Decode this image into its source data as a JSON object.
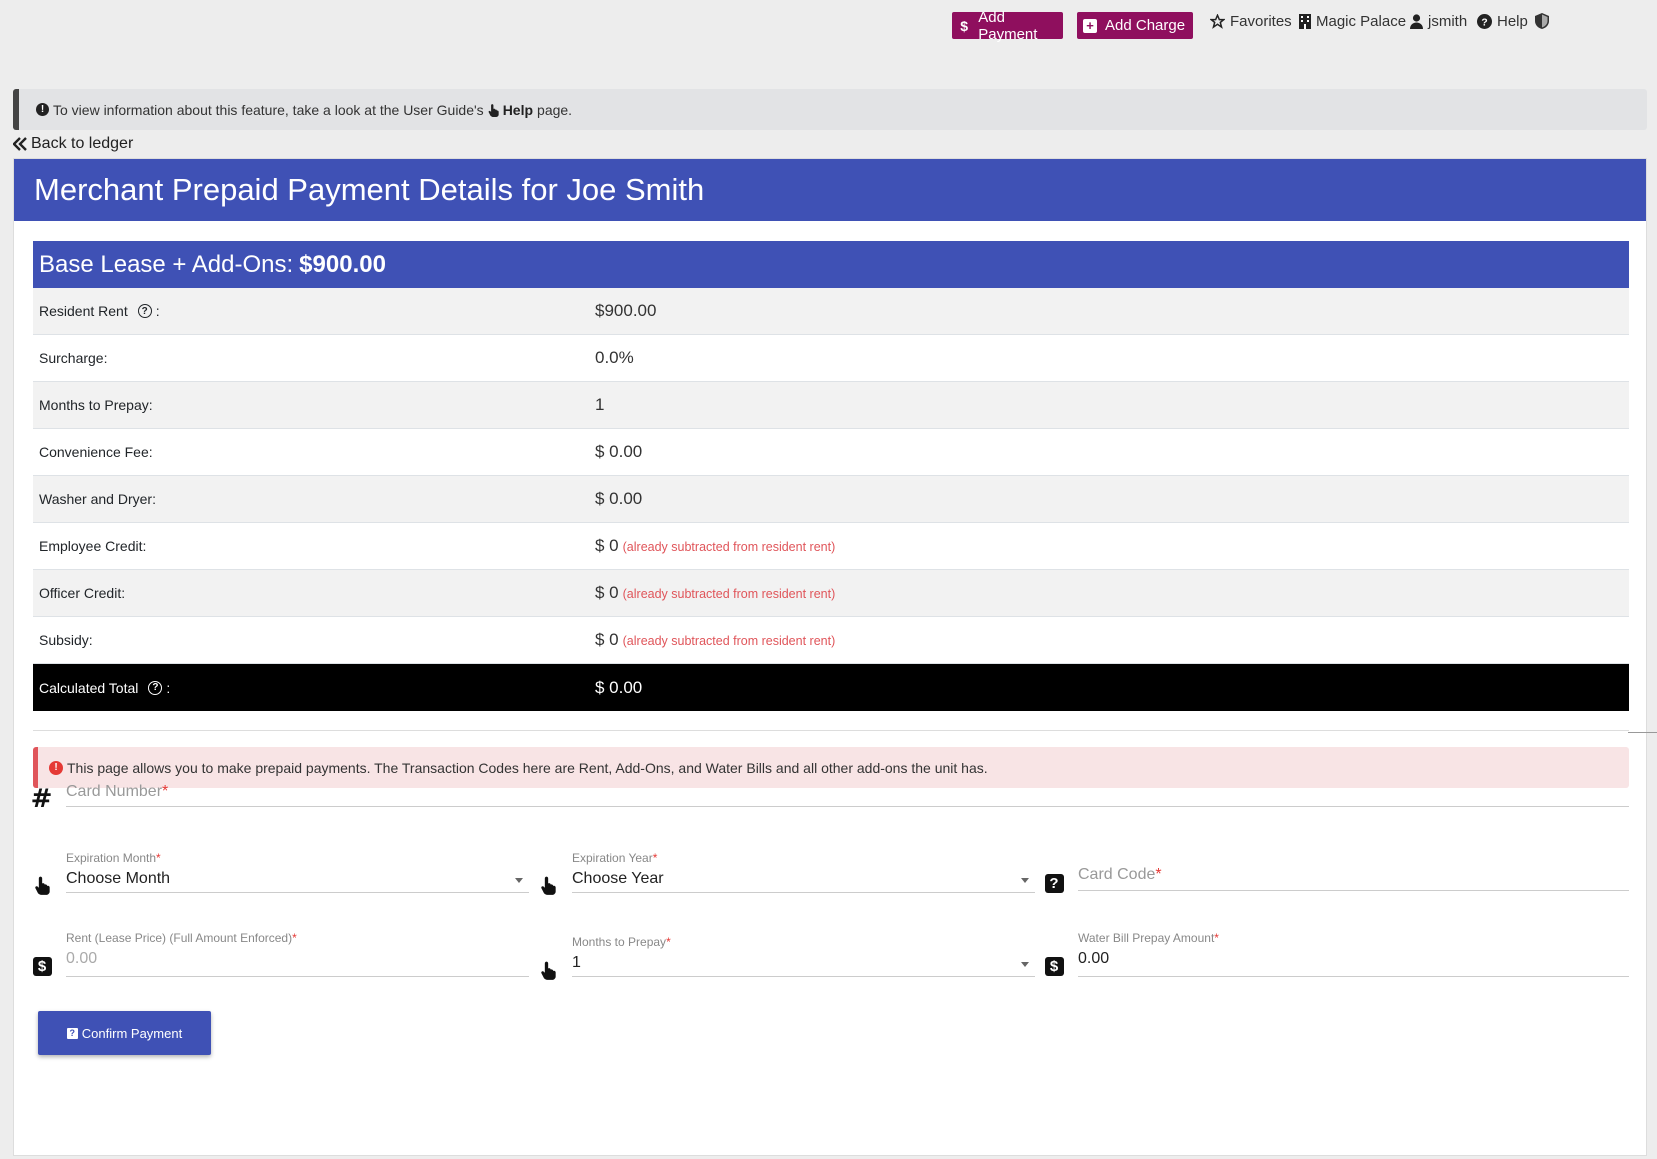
{
  "topnav": {
    "add_payment": "Add Payment",
    "add_charge": "Add Charge",
    "favorites": "Favorites",
    "property": "Magic Palace",
    "user": "jsmith",
    "help": "Help"
  },
  "info_banner": {
    "text_before": "To view information about this feature, take a look at the User Guide's",
    "help_word": "Help",
    "text_after": "page."
  },
  "back_link": "Back to ledger",
  "card": {
    "title": "Merchant Prepaid Payment Details for Joe Smith",
    "subhead_label": "Base Lease + Add-Ons:",
    "subhead_amount": "$900.00",
    "rows": [
      {
        "label": "Resident Rent",
        "value": "$900.00",
        "note": ""
      },
      {
        "label": "Surcharge:",
        "value": "0.0%",
        "note": ""
      },
      {
        "label": "Months to Prepay:",
        "value": "1",
        "note": ""
      },
      {
        "label": "Convenience Fee:",
        "value": "$ 0.00",
        "note": ""
      },
      {
        "label": "Washer and Dryer:",
        "value": "$ 0.00",
        "note": ""
      },
      {
        "label": "Employee Credit:",
        "value": "$ 0",
        "note": "(already subtracted from resident rent)"
      },
      {
        "label": "Officer Credit:",
        "value": "$ 0",
        "note": "(already subtracted from resident rent)"
      },
      {
        "label": "Subsidy:",
        "value": "$ 0",
        "note": "(already subtracted from resident rent)"
      }
    ],
    "total_label": "Calculated Total",
    "total_value": "$ 0.00",
    "colon": ":"
  },
  "alert": "This page allows you to make prepaid payments. The Transaction Codes here are Rent, Add-Ons, and Water Bills and all other add-ons the unit has.",
  "form": {
    "card_number_placeholder": "Card Number",
    "expiration_month_label": "Expiration Month",
    "expiration_month_value": "Choose Month",
    "expiration_year_label": "Expiration Year",
    "expiration_year_value": "Choose Year",
    "card_code_placeholder": "Card Code",
    "rent_label": "Rent (Lease Price) (Full Amount Enforced)",
    "rent_value": "0.00",
    "months_label": "Months to Prepay",
    "months_value": "1",
    "water_label": "Water Bill Prepay Amount",
    "water_value": "0.00",
    "required_mark": "*"
  },
  "confirm_button": "Confirm Payment",
  "colors": {
    "primary": "#3f51b5",
    "maroon": "#8f0f5e",
    "alert_red": "#e0555a"
  }
}
